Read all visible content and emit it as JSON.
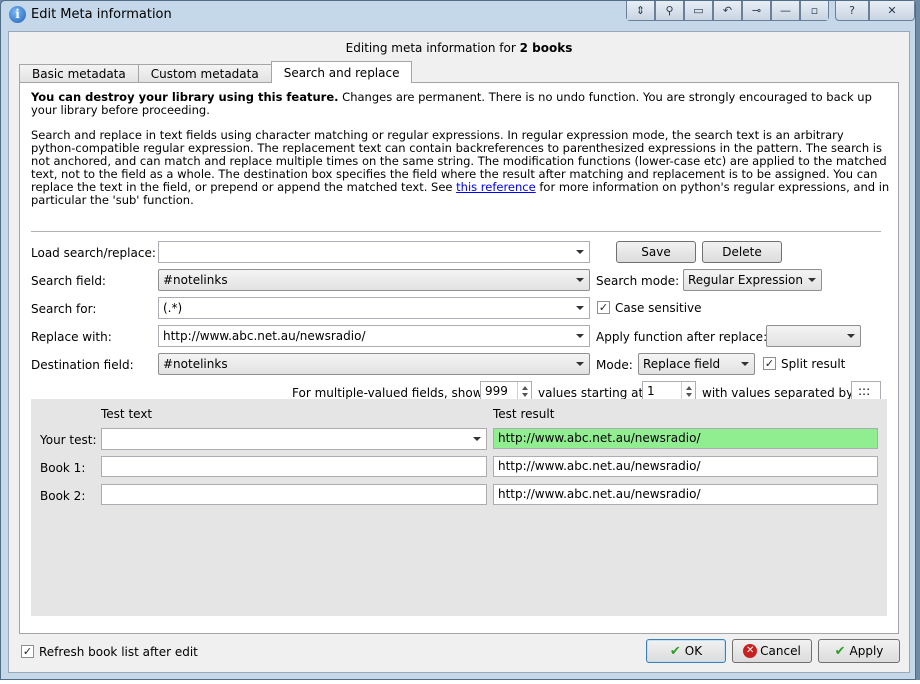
{
  "window": {
    "title": "Edit Meta information",
    "title_icon": "info-icon",
    "help_label": "?",
    "close_label": "✕"
  },
  "header": {
    "subtitle_prefix": "Editing meta information for ",
    "subtitle_count": "2 books"
  },
  "tabs": [
    {
      "label": "Basic metadata",
      "active": false
    },
    {
      "label": "Custom metadata",
      "active": false
    },
    {
      "label": "Search and replace",
      "active": true
    }
  ],
  "info": {
    "warning_bold": "You can destroy your library using this feature.",
    "warning_rest": " Changes are permanent. There is no undo function. You are strongly encouraged to back up your library before proceeding.",
    "desc_before": "Search and replace in text fields using character matching or regular expressions. In regular expression mode, the search text is an arbitrary python-compatible regular expression. The replacement text can contain backreferences to parenthesized expressions in the pattern. The search is not anchored, and can match and replace multiple times on the same string. The modification functions (lower-case etc) are applied to the matched text, not to the field as a whole. The destination box specifies the field where the result after matching and replacement is to be assigned. You can replace the text in the field, or prepend or append the matched text. See ",
    "desc_link": "this reference",
    "desc_after": " for more information on python's regular expressions, and in particular the 'sub' function."
  },
  "form": {
    "load_label": "Load search/replace:",
    "load_value": "",
    "save_label": "Save",
    "delete_label": "Delete",
    "search_field_label": "Search field:",
    "search_field_value": "#notelinks",
    "search_mode_label": "Search mode:",
    "search_mode_value": "Regular Expression",
    "search_for_label": "Search for:",
    "search_for_value": "(.*)",
    "case_sensitive_label": "Case sensitive",
    "case_sensitive_checked": true,
    "replace_with_label": "Replace with:",
    "replace_with_value": "http://www.abc.net.au/newsradio/",
    "apply_function_label": "Apply function after replace:",
    "apply_function_value": "",
    "destination_label": "Destination field:",
    "destination_value": "#notelinks",
    "mode_label": "Mode:",
    "mode_value": "Replace field",
    "split_result_label": "Split result",
    "split_result_checked": true,
    "multi_label_show": "For multiple-valued fields, show",
    "multi_show_value": "999",
    "multi_label_start": "values starting at",
    "multi_start_value": "1",
    "multi_label_sep": "with values separated by",
    "multi_sep_value": ":::"
  },
  "test": {
    "test_text_header": "Test text",
    "test_result_header": "Test result",
    "rows": [
      {
        "label": "Your test:",
        "text": "",
        "result": "http://www.abc.net.au/newsradio/"
      },
      {
        "label": "Book 1:",
        "text": "",
        "result": "http://www.abc.net.au/newsradio/"
      },
      {
        "label": "Book 2:",
        "text": "",
        "result": "http://www.abc.net.au/newsradio/"
      }
    ],
    "match_color": "#90ee90"
  },
  "footer": {
    "refresh_label": "Refresh book list after edit",
    "refresh_checked": true,
    "ok_label": "OK",
    "cancel_label": "Cancel",
    "apply_label": "Apply"
  }
}
